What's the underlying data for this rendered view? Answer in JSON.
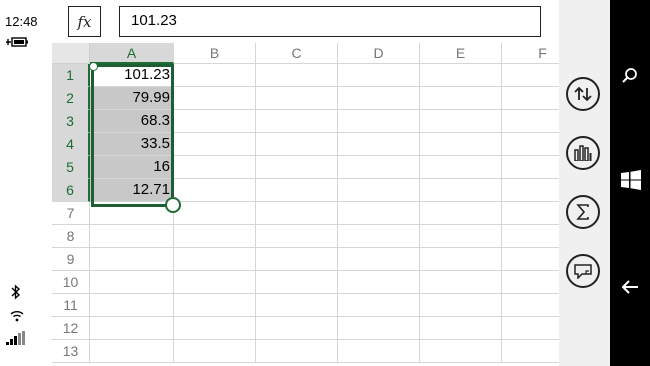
{
  "status": {
    "time": "12:48"
  },
  "formula": {
    "fx_label": "fx",
    "value": "101.23"
  },
  "columns": [
    "A",
    "B",
    "C",
    "D",
    "E",
    "F"
  ],
  "rows": [
    "1",
    "2",
    "3",
    "4",
    "5",
    "6",
    "7",
    "8",
    "9",
    "10",
    "11",
    "12",
    "13"
  ],
  "cells_A": [
    "101.23",
    "79.99",
    "68.3",
    "33.5",
    "16",
    "12.71"
  ],
  "selection": {
    "range": "A1:A6",
    "accent": "#1e6b35"
  },
  "appbar": {
    "buttons": [
      "sort-icon",
      "chart-icon",
      "sum-icon",
      "comment-icon"
    ]
  },
  "navbar": {
    "buttons": [
      "search-icon",
      "windows-icon",
      "back-icon"
    ]
  }
}
